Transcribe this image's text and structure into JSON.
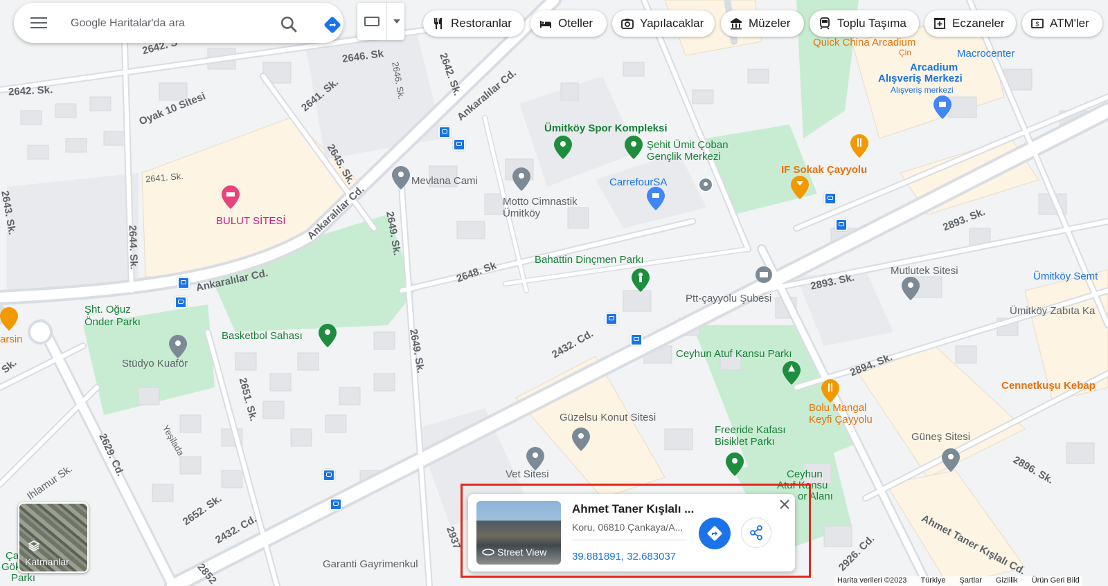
{
  "search": {
    "placeholder": "Google Haritalar'da ara"
  },
  "chips": [
    {
      "label": "Restoranlar",
      "icon": "fork-knife-icon"
    },
    {
      "label": "Oteller",
      "icon": "bed-icon"
    },
    {
      "label": "Yapılacaklar",
      "icon": "camera-icon"
    },
    {
      "label": "Müzeler",
      "icon": "museum-icon"
    },
    {
      "label": "Toplu Taşıma",
      "icon": "train-icon"
    },
    {
      "label": "Eczaneler",
      "icon": "pharmacy-icon"
    },
    {
      "label": "ATM'ler",
      "icon": "atm-icon"
    }
  ],
  "streets": {
    "s2642a": "2642. S",
    "s2642b": "2642. Sk.",
    "s2646": "2646. Sk",
    "s2646v": "2646. Sk.",
    "s2642c": "2642. Sk.",
    "s2641": "2641. Sk.",
    "s2641b": "2641. Sk.",
    "s2645": "2645. Sk.",
    "ankara1": "Ankaralılar Cd.",
    "ankara2": "Ankaralılar Cd.",
    "ankara3": "Ankaralılar Cd.",
    "oyak": "Oyak 10 Sitesi",
    "s2643": "2643. Sk.",
    "s2644": "2644. Sk.",
    "s2649a": "2649. Sk.",
    "s2649b": "2649. Sk.",
    "s2648": "2648. Sk",
    "s2432a": "2432. Cd.",
    "s2432b": "2432. Cd.",
    "s2651": "2651. Sk.",
    "s2652": "2652. Sk.",
    "s2629": "2629. Cd.",
    "ihlamur": "Ihlamur Sk.",
    "yesilada": "Yeşilada",
    "s2893a": "2893. Sk.",
    "s2893b": "2893. Sk.",
    "s2894": "2894. Sk.",
    "s2896": "2896. Sk.",
    "s2926": "2926. Cd.",
    "ahmet": "Ahmet Taner Kışlalı Cd.",
    "s2937": "2937",
    "s2852": "2852",
    "sk_left": "Sk."
  },
  "places": {
    "quick_china": "Quick China Arcadium",
    "cin": "Çin",
    "macrocenter": "Macrocenter",
    "arcadium": "Arcadium",
    "avm": "Alışveriş Merkezi",
    "avm_sub": "Alışveriş merkezi",
    "umitkoy_spor": "Ümitköy Spor Kompleksi",
    "sehit_umit": "Şehit Ümit Çoban",
    "genclik": "Gençlik Merkezi",
    "mevlana": "Mevlana Cami",
    "carrefour": "CarrefourSA",
    "motto1": "Motto Cimnastik",
    "motto2": "Ümitköy",
    "if_sokak": "IF Sokak Çayyolu",
    "bulut": "BULUT SİTESİ",
    "bahattin": "Bahattin Dinçmen Parkı",
    "mutlutek": "Mutlutek Sitesi",
    "umitkoy_semt": "Ümitköy Semt",
    "ptt": "Ptt-çayyolu Şubesi",
    "zabita": "Ümitköy Zabıta Ka",
    "sht_oguz1": "Şht. Oğuz",
    "sht_oguz2": "Önder Parkı",
    "arsin": "arsin",
    "basketbol": "Basketbol Sahası",
    "studyo": "Stüdyo Kuaför",
    "ceyhun_park": "Ceyhun Atuf Kansu Parkı",
    "cennet": "Cennetkuşu Kebap",
    "bolu1": "Bolu Mangal",
    "bolu2": "Keyfi Çayyolu",
    "guzelsu": "Güzelsu Konut Sitesi",
    "freeride1": "Freeride Kafası",
    "freeride2": "Bisiklet Parkı",
    "gunes": "Güneş Sitesi",
    "vet": "Vet Sitesi",
    "ceyhun_b1": "Ceyhun",
    "ceyhun_b2": "Atuf Kansu",
    "ceyhun_b3": "or Alanı",
    "garanti": "Garanti Gayrimenkul",
    "cag1": "Ça",
    "cag2": "Gök",
    "cag3": "Parkı"
  },
  "card": {
    "title": "Ahmet Taner Kışlalı ...",
    "address": "Koru, 06810 Çankaya/A...",
    "coords": "39.881891, 32.683037",
    "street_view": "Street View"
  },
  "layers": {
    "label": "Katmanlar"
  },
  "footer": [
    "Harita verileri ©2023",
    "Türkiye",
    "Şartlar",
    "Gizlilik",
    "Ürün Geri Bild"
  ],
  "colors": {
    "road": "#d9dde3",
    "green": "#c8ecd2",
    "building": "#e8eaed",
    "residential": "#fdf4e3",
    "accent": "#1a73e8"
  }
}
